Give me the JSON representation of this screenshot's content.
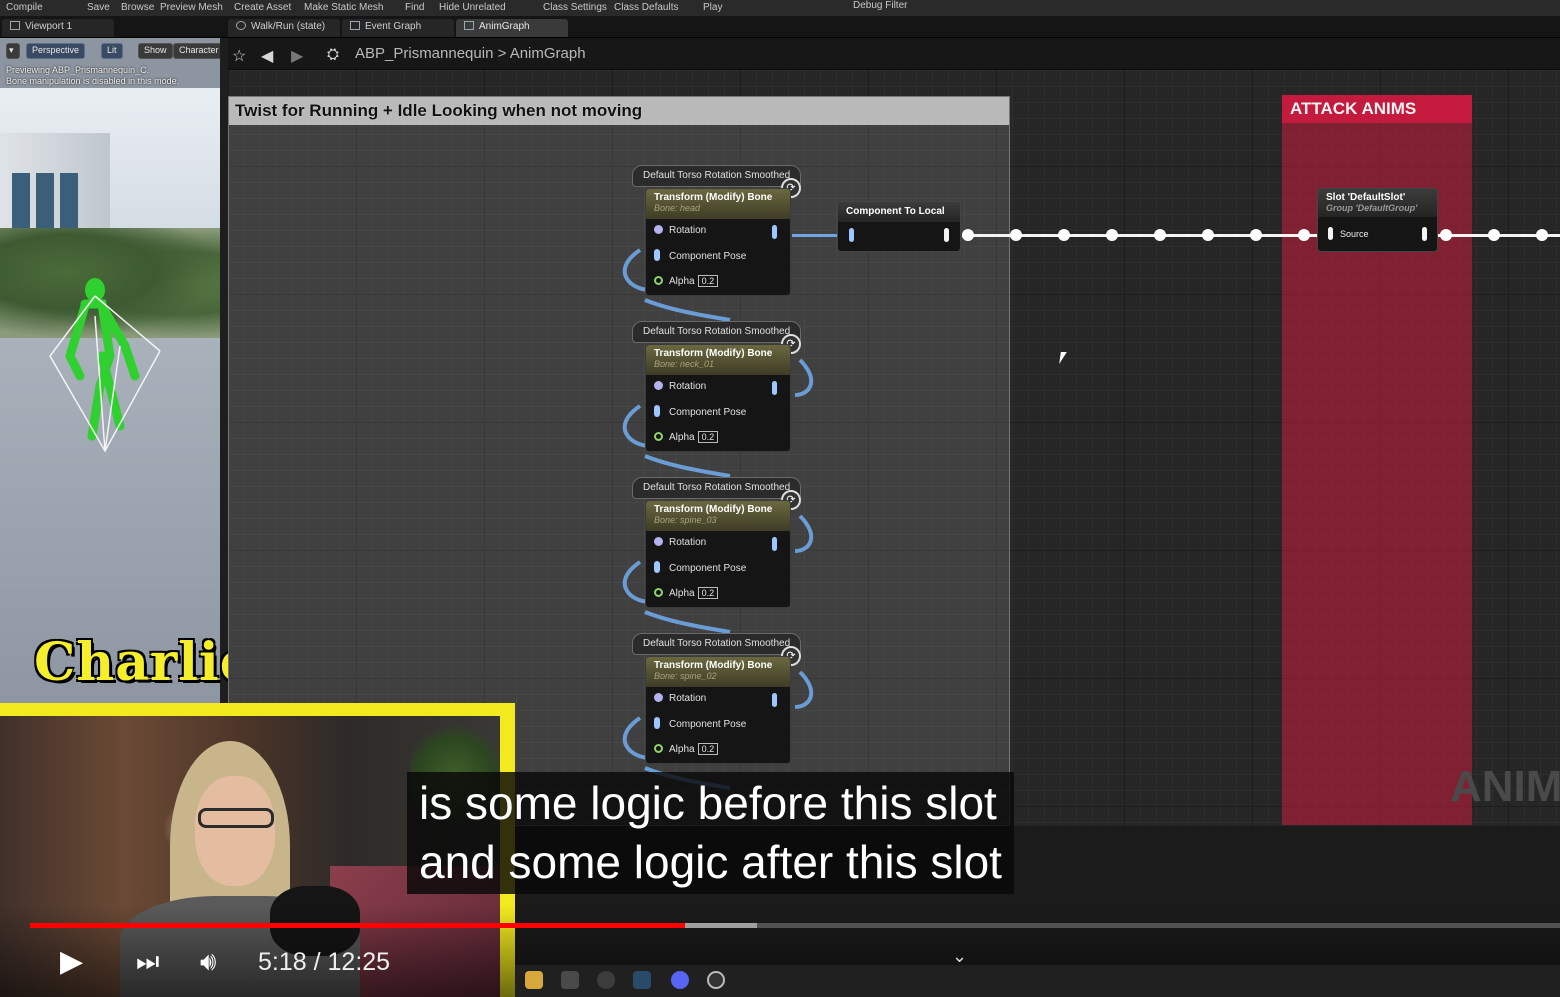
{
  "menu": [
    "Compile",
    "Save",
    "Browse",
    "Preview Mesh",
    "Create Asset",
    "Make Static Mesh",
    "Find",
    "Hide Unrelated",
    "Class Settings",
    "Class Defaults",
    "Play",
    "Debug Filter"
  ],
  "tabs": {
    "viewport": "Viewport 1",
    "walk_run": "Walk/Run (state)",
    "event_graph": "Event Graph",
    "anim_graph": "AnimGraph"
  },
  "viewport": {
    "buttons": {
      "perspective": "Perspective",
      "lit": "Lit",
      "show": "Show",
      "character": "Character"
    },
    "info_line1": "Previewing ABP_Prismannequin_C.",
    "info_line2": "Bone manipulation is disabled in this mode."
  },
  "graph": {
    "breadcrumb_root": "ABP_Prismannequin",
    "breadcrumb_sep": ">",
    "breadcrumb_leaf": "AnimGraph",
    "comment_title": "Twist for Running + Idle Looking when not moving",
    "attack_title": "ATTACK ANIMS",
    "anim_ghost": "ANIM",
    "nodes": [
      {
        "header": "Default Torso Rotation Smoothed",
        "title": "Transform (Modify) Bone",
        "bone": "Bone: head",
        "pin_rotation": "Rotation",
        "pin_pose": "Component Pose",
        "pin_alpha": "Alpha",
        "alpha": "0.2"
      },
      {
        "header": "Default Torso Rotation Smoothed",
        "title": "Transform (Modify) Bone",
        "bone": "Bone: neck_01",
        "pin_rotation": "Rotation",
        "pin_pose": "Component Pose",
        "pin_alpha": "Alpha",
        "alpha": "0.2"
      },
      {
        "header": "Default Torso Rotation Smoothed",
        "title": "Transform (Modify) Bone",
        "bone": "Bone: spine_03",
        "pin_rotation": "Rotation",
        "pin_pose": "Component Pose",
        "pin_alpha": "Alpha",
        "alpha": "0.2"
      },
      {
        "header": "Default Torso Rotation Smoothed",
        "title": "Transform (Modify) Bone",
        "bone": "Bone: spine_02",
        "pin_rotation": "Rotation",
        "pin_pose": "Component Pose",
        "pin_alpha": "Alpha",
        "alpha": "0.2"
      }
    ],
    "component_to_local": "Component To Local",
    "slot_title": "Slot 'DefaultSlot'",
    "slot_group": "Group 'DefaultGroup'",
    "slot_source": "Source"
  },
  "overlay": {
    "streamer_name": "Charlie",
    "caption_line1": "is some logic before this slot",
    "caption_line2": "and some logic after this slot"
  },
  "player": {
    "current_time": "5:18",
    "separator": " / ",
    "duration": "12:25",
    "progress_fraction": 0.428,
    "buffered_fraction": 0.475,
    "progress_color": "#ff0000"
  },
  "icons": [
    "play-icon",
    "next-icon",
    "volume-icon",
    "chevron-down-icon",
    "star-icon",
    "back-arrow-icon",
    "forward-arrow-icon"
  ],
  "colors": {
    "attack_comment": "#c31a3d",
    "charlie_text": "#f5ee2c",
    "webcam_frame": "#f2ea1e"
  }
}
